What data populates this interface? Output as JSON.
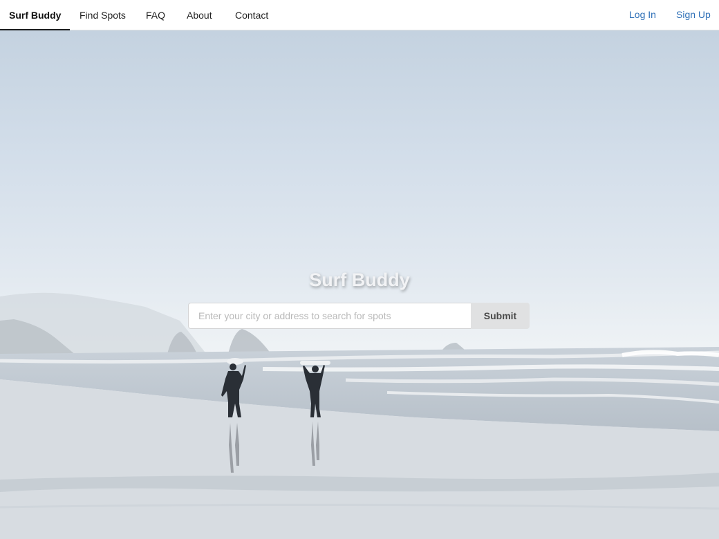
{
  "nav": {
    "brand": "Surf Buddy",
    "links": [
      "Find Spots",
      "FAQ",
      "About",
      "Contact"
    ],
    "login": "Log In",
    "signup": "Sign Up"
  },
  "hero": {
    "title": "Surf Buddy",
    "search_placeholder": "Enter your city or address to search for spots",
    "search_value": "",
    "submit_label": "Submit"
  },
  "colors": {
    "link_blue": "#2d6fb7",
    "button_gray": "#e0e1e2"
  }
}
